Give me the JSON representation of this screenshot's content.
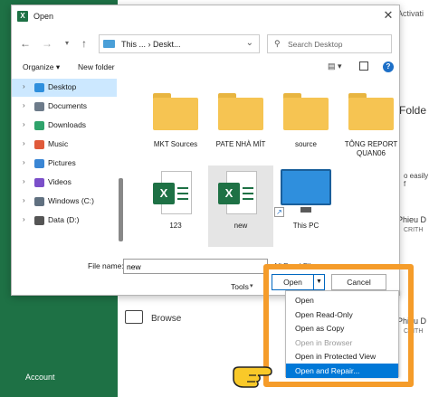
{
  "background": {
    "account_label": "Account",
    "activate_text": "Activati",
    "folder_text": "Folde",
    "easily_text": "o easily f",
    "phieu_1": "Phieu D",
    "phieu_1_sub": "CRITH",
    "phieu_2": "Phieu D",
    "phieu_2_sub": "CRITH",
    "browse_label": "Browse"
  },
  "dialog": {
    "title": "Open",
    "address_path": "This ... › Deskt...",
    "search_placeholder": "Search Desktop",
    "toolbar": {
      "organize": "Organize ▾",
      "new_folder": "New folder"
    },
    "nav_items": [
      {
        "label": "Desktop",
        "color": "#2f8fdd",
        "selected": true
      },
      {
        "label": "Documents",
        "color": "#6d7b8a"
      },
      {
        "label": "Downloads",
        "color": "#2fa36b"
      },
      {
        "label": "Music",
        "color": "#e05a3a"
      },
      {
        "label": "Pictures",
        "color": "#3a86d4"
      },
      {
        "label": "Videos",
        "color": "#7b4fc9"
      },
      {
        "label": "Windows (C:)",
        "color": "#607080"
      },
      {
        "label": "Data (D:)",
        "color": "#555555"
      }
    ],
    "files": [
      {
        "label": "MKT Sources",
        "type": "folder"
      },
      {
        "label": "PATE NHÀ MÍT",
        "type": "folder"
      },
      {
        "label": "source",
        "type": "folder"
      },
      {
        "label": "TÔNG REPORT QUAN06",
        "type": "folder"
      },
      {
        "label": "123",
        "type": "excel"
      },
      {
        "label": "new",
        "type": "excel",
        "selected": true
      },
      {
        "label": "This PC",
        "type": "pc"
      }
    ],
    "filename_label": "File name:",
    "filename_value": "new",
    "filetype_value": "All Excel Files",
    "tools_label": "Tools",
    "open_button": "Open",
    "cancel_button": "Cancel",
    "open_menu": [
      {
        "label": "Open",
        "enabled": true
      },
      {
        "label": "Open Read-Only",
        "enabled": true
      },
      {
        "label": "Open as Copy",
        "enabled": true
      },
      {
        "label": "Open in Browser",
        "enabled": false
      },
      {
        "label": "Open in Protected View",
        "enabled": true
      },
      {
        "label": "Open and Repair...",
        "enabled": true,
        "highlighted": true
      }
    ]
  },
  "colors": {
    "excel_green": "#1e7145",
    "highlight_orange": "#f59c2a",
    "selection_blue": "#0078d7"
  }
}
